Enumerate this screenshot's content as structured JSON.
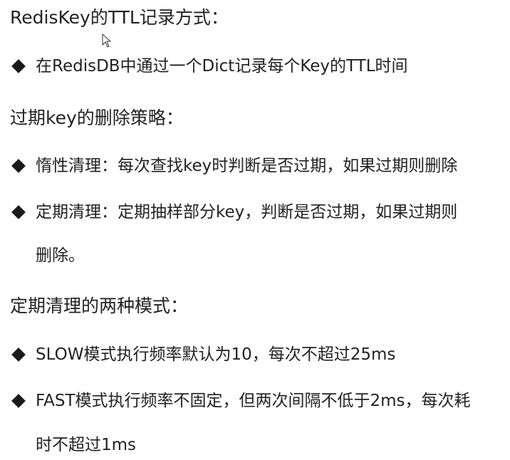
{
  "heading1": "RedisKey的TTL记录方式：",
  "bullet1": "在RedisDB中通过一个Dict记录每个Key的TTL时间",
  "heading2": "过期key的删除策略：",
  "bullet2": "惰性清理：每次查找key时判断是否过期，如果过期则删除",
  "bullet3_line1": "定期清理：定期抽样部分key，判断是否过期，如果过期则",
  "bullet3_line2": "删除。",
  "heading3": "定期清理的两种模式：",
  "bullet4": "SLOW模式执行频率默认为10，每次不超过25ms",
  "bullet5_line1": "FAST模式执行频率不固定，但两次间隔不低于2ms，每次耗",
  "bullet5_line2": "时不超过1ms"
}
